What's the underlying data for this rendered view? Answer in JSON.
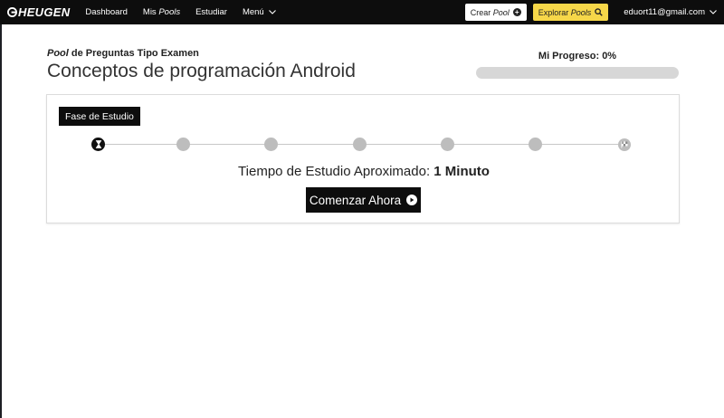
{
  "navbar": {
    "brand": "HEUGEN",
    "links": [
      {
        "label": "Dashboard"
      },
      {
        "prefix": "Mis ",
        "italic": "Pools"
      },
      {
        "label": "Estudiar"
      }
    ],
    "menu_label": "Menú",
    "crear_prefix": "Crear ",
    "crear_italic": "Pool",
    "explorar_prefix": "Explorar ",
    "explorar_italic": "Pools",
    "user_email": "eduort11@gmail.com"
  },
  "header": {
    "subtitle_italic": "Pool",
    "subtitle_rest": " de Preguntas Tipo Examen",
    "title": "Conceptos de programación Android",
    "progress_label": "Mi Progreso: 0%",
    "progress_value": 0
  },
  "card": {
    "phase_label": "Fase de Estudio",
    "steps_total": 7,
    "active_step": 0,
    "time_prefix": "Tiempo de Estudio Aproximado: ",
    "time_value": "1 Minuto",
    "start_button": "Comenzar Ahora"
  },
  "colors": {
    "navbar_bg": "#0d0d0d",
    "accent_yellow": "#f6d749",
    "progress_track": "#d7d7d7",
    "step_inactive": "#bdbdbd"
  }
}
